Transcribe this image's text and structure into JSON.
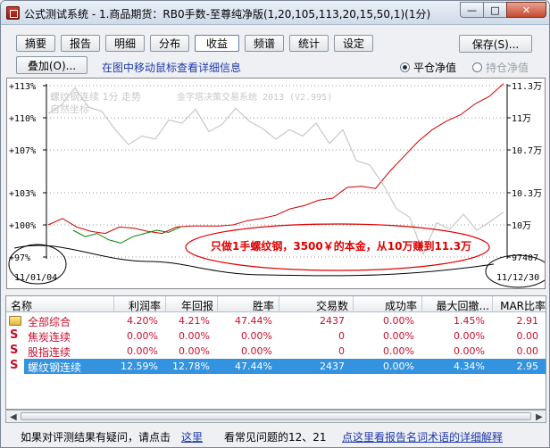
{
  "window": {
    "title": "公式测试系统 - 1.商品期货：RB0手数-至尊纯净版(1,20,105,113,20,15,50,1)(1分)",
    "minimize_glyph": "—",
    "maximize_glyph": "□",
    "close_glyph": "✕",
    "icon": "app-icon"
  },
  "tabs": [
    {
      "label": "摘要"
    },
    {
      "label": "报告"
    },
    {
      "label": "明细"
    },
    {
      "label": "分布"
    },
    {
      "label": "收益"
    },
    {
      "label": "频谱"
    },
    {
      "label": "统计"
    },
    {
      "label": "设定"
    }
  ],
  "active_tab": "收益",
  "save_button": "保存(S)...",
  "overlay_button": "叠加(O)...",
  "hint_text": "在图中移动鼠标查看详细信息",
  "radio_options": [
    {
      "label": "平仓净值",
      "selected": true
    },
    {
      "label": "持仓净值",
      "selected": false
    }
  ],
  "chart": {
    "left_axis_labels": [
      "+113%",
      "+110%",
      "+107%",
      "+103%",
      "+100%",
      "+97%"
    ],
    "right_axis_labels": [
      "11.3万",
      "11万",
      "10.7万",
      "10.3万",
      "10万",
      "97407"
    ],
    "legend_line1": "螺纹钢连续 1分 走势",
    "legend_line2": "自然坐标",
    "system_label": "金字塔决策交易系统 2013 (V2.995)",
    "start_date": "11/01/04",
    "end_date": "11/12/30",
    "annotation": "只做1手螺纹钢，3500￥的本金，从10万赚到11.3万",
    "colors": {
      "equity": "#d00000",
      "drawdown": "#008000",
      "price": "#c8c8c8",
      "annotation": "#e00000"
    }
  },
  "chart_data": {
    "type": "line",
    "x_start": "11/01/04",
    "x_end": "11/12/30",
    "ylim_left_pct": [
      97,
      113
    ],
    "ylim_right": [
      97407,
      113000
    ],
    "series": [
      {
        "name": "",
        "role": "equity",
        "values": [
          100.0,
          100.6,
          99.8,
          99.4,
          99.2,
          99.8,
          99.7,
          99.4,
          99.2,
          99.8,
          99.9,
          99.9,
          99.9,
          100.0,
          100.4,
          100.6,
          100.9,
          101.5,
          101.8,
          102.3,
          102.5,
          103.5,
          103.6,
          103.4,
          105.0,
          106.4,
          107.8,
          108.9,
          109.7,
          110.3,
          111.3,
          112.0,
          113.2
        ]
      },
      {
        "name": "",
        "role": "drawdown",
        "values": [
          99.5,
          98.9,
          99.2,
          98.6,
          98.3,
          98.9,
          99.2,
          99.5,
          99.3,
          99.8
        ]
      },
      {
        "name": "螺纹钢连续",
        "role": "price",
        "values": [
          110.4,
          111.2,
          112.8,
          111.0,
          110.6,
          108.9,
          107.5,
          108.3,
          108.0,
          109.8,
          109.5,
          110.8,
          108.7,
          109.4,
          110.9,
          109.7,
          109.0,
          108.0,
          108.9,
          108.3,
          109.5,
          107.6,
          108.9,
          106.0,
          105.6,
          103.8,
          101.5,
          100.7,
          97.3,
          100.2,
          99.6,
          101.0,
          99.5,
          100.3,
          101.2
        ]
      }
    ]
  },
  "table": {
    "headers": [
      "名称",
      "利润率",
      "年回报",
      "胜率",
      "交易数",
      "成功率",
      "最大回撤...",
      "MAR比率"
    ],
    "rows": [
      {
        "icon": "folder-icon",
        "name": "全部综合",
        "values": [
          "4.20%",
          "4.21%",
          "47.44%",
          "2437",
          "0.00%",
          "1.45%",
          "2.91"
        ],
        "selected": false
      },
      {
        "icon": "s-icon",
        "name": "焦炭连续",
        "values": [
          "0.00%",
          "0.00%",
          "0.00%",
          "0",
          "0.00%",
          "0.00%",
          "0.00"
        ],
        "selected": false
      },
      {
        "icon": "s-icon",
        "name": "股指连续",
        "values": [
          "0.00%",
          "0.00%",
          "0.00%",
          "0",
          "0.00%",
          "0.00%",
          "0.00"
        ],
        "selected": false
      },
      {
        "icon": "s-icon",
        "name": "螺纹钢连续",
        "values": [
          "12.59%",
          "12.78%",
          "47.44%",
          "2437",
          "0.00%",
          "4.34%",
          "2.95"
        ],
        "selected": true
      }
    ]
  },
  "scroll": {
    "left_arrow": "◀",
    "right_arrow": "▶"
  },
  "footer": {
    "question_text": "如果对评测结果有疑问，请点击",
    "here_link": "这里",
    "faq_text": "看常见问题的12、21",
    "terms_link": "点这里看报告名词术语的详细解释"
  }
}
